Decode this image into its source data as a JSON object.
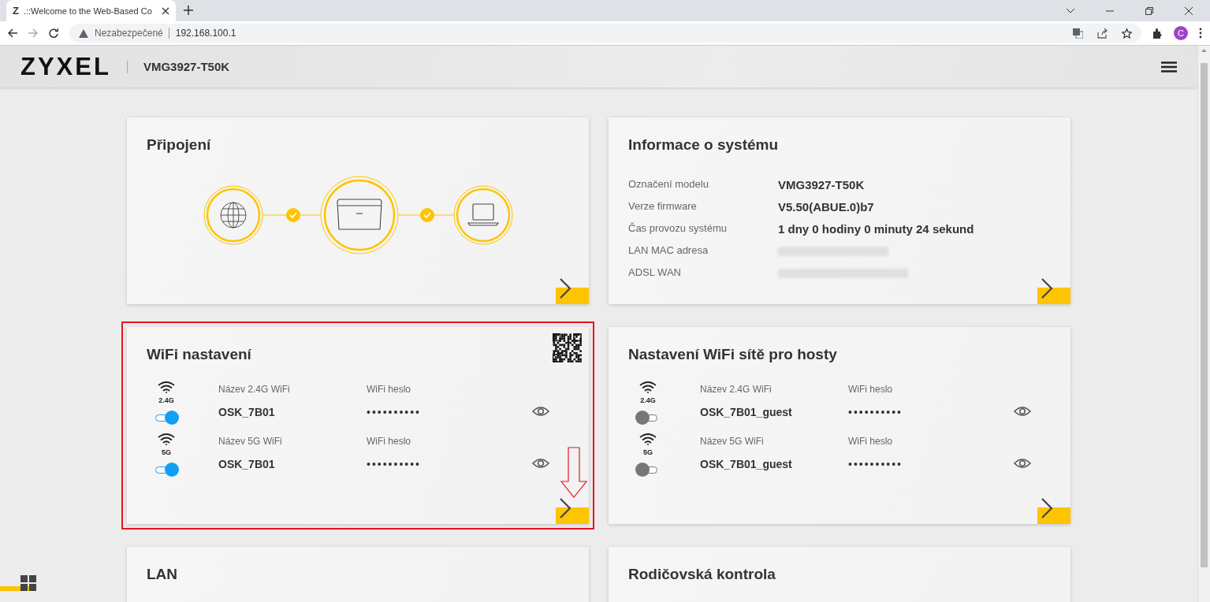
{
  "browser": {
    "favicon": "Z",
    "tab_title": ".::Welcome to the Web-Based Co",
    "security": "Nezabezpečené",
    "url": "192.168.100.1",
    "profile_initial": "C"
  },
  "header": {
    "logo": "ZYXEL",
    "model": "VMG3927-T50K"
  },
  "cards": [
    {
      "kind": "connection",
      "title": "Připojení",
      "links": [
        {
          "ok": true
        },
        {
          "ok": true
        }
      ]
    },
    {
      "kind": "info",
      "title": "Informace o systému",
      "rows": [
        {
          "label": "Označení modelu",
          "value": "VMG3927-T50K",
          "redacted": false
        },
        {
          "label": "Verze firmware",
          "value": "V5.50(ABUE.0)b7",
          "redacted": false
        },
        {
          "label": "Čas provozu systému",
          "value": "1 dny 0 hodiny 0 minuty 24 sekund",
          "redacted": false
        },
        {
          "label": "LAN MAC adresa",
          "redacted": true
        },
        {
          "label": "ADSL WAN",
          "redacted": true
        }
      ]
    },
    {
      "kind": "wifi",
      "title": "WiFi nastavení",
      "highlighted": true,
      "qr": true,
      "networks": [
        {
          "band": "2.4G",
          "name_label": "Název 2.4G WiFi",
          "name": "OSK_7B01",
          "password_label": "WiFi heslo",
          "password": "••••••••••",
          "on": true
        },
        {
          "band": "5G",
          "name_label": "Název 5G WiFi",
          "name": "OSK_7B01",
          "password_label": "WiFi heslo",
          "password": "••••••••••",
          "on": true
        }
      ]
    },
    {
      "kind": "wifi",
      "title": "Nastavení WiFi sítě pro hosty",
      "highlighted": false,
      "qr": false,
      "networks": [
        {
          "band": "2.4G",
          "name_label": "Název 2.4G WiFi",
          "name": "OSK_7B01_guest",
          "password_label": "WiFi heslo",
          "password": "••••••••••",
          "on": false
        },
        {
          "band": "5G",
          "name_label": "Název 5G WiFi",
          "name": "OSK_7B01_guest",
          "password_label": "WiFi heslo",
          "password": "••••••••••",
          "on": false
        }
      ]
    },
    {
      "kind": "plain",
      "title": "LAN"
    },
    {
      "kind": "plain",
      "title": "Rodičovská kontrola"
    }
  ]
}
